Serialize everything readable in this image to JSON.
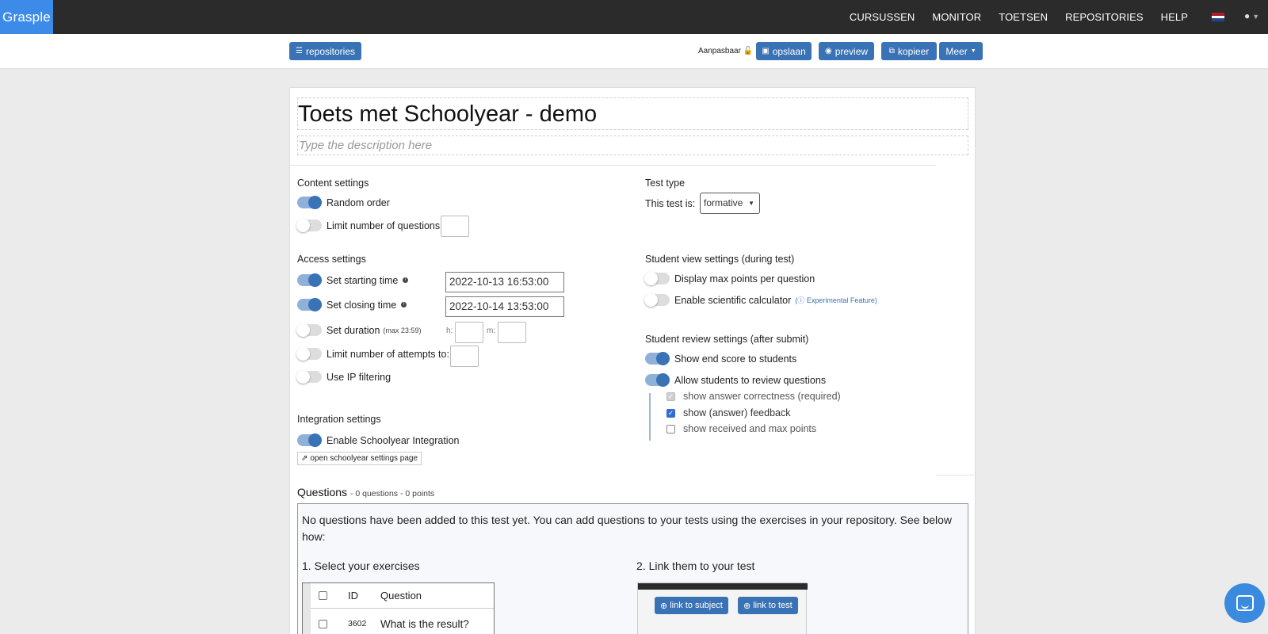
{
  "app": {
    "logo": "Grasple"
  },
  "nav": {
    "items": [
      {
        "label": "CURSUSSEN"
      },
      {
        "label": "MONITOR"
      },
      {
        "label": "TOETSEN"
      },
      {
        "label": "REPOSITORIES"
      },
      {
        "label": "HELP"
      }
    ],
    "language_flag": "flag-nl-icon",
    "user": "user-icon"
  },
  "toolbar": {
    "repositories": "repositories",
    "editable_label": "Aanpasbaar",
    "save": "opslaan",
    "preview": "preview",
    "copy": "kopieer",
    "more": "Meer"
  },
  "test": {
    "title": "Toets met Schoolyear - demo",
    "description_placeholder": "Type the description here"
  },
  "content_settings": {
    "heading": "Content settings",
    "random_order": {
      "label": "Random order",
      "on": true
    },
    "limit_questions": {
      "label": "Limit number of questions",
      "on": false,
      "value": ""
    }
  },
  "access_settings": {
    "heading": "Access settings",
    "starting_time": {
      "label": "Set starting time",
      "on": true,
      "value": "2022-10-13 16:53:00"
    },
    "closing_time": {
      "label": "Set closing time",
      "on": true,
      "value": "2022-10-14 13:53:00"
    },
    "duration": {
      "label": "Set duration",
      "hint": "(max 23:59)",
      "on": false,
      "h_label": "h:",
      "m_label": "m:"
    },
    "attempts": {
      "label": "Limit number of attempts to:",
      "on": false
    },
    "ip_filtering": {
      "label": "Use IP filtering",
      "on": false
    }
  },
  "integration_settings": {
    "heading": "Integration settings",
    "schoolyear": {
      "label": "Enable Schoolyear Integration",
      "on": true
    },
    "open_settings": "open schoolyear settings page"
  },
  "test_type": {
    "heading": "Test type",
    "label": "This test is:",
    "value": "formative"
  },
  "student_view": {
    "heading": "Student view settings (during test)",
    "max_points": {
      "label": "Display max points per question",
      "on": false
    },
    "calculator": {
      "label": "Enable scientific calculator",
      "on": false,
      "experimental": "Experimental Feature"
    }
  },
  "student_review": {
    "heading": "Student review settings (after submit)",
    "end_score": {
      "label": "Show end score to students",
      "on": true
    },
    "review_questions": {
      "label": "Allow students to review questions",
      "on": true
    },
    "options": [
      {
        "label": "show answer correctness (required)",
        "checked": true,
        "disabled": true
      },
      {
        "label": "show (answer) feedback",
        "checked": true,
        "disabled": false
      },
      {
        "label": "show received and max points",
        "checked": false,
        "disabled": false
      }
    ]
  },
  "questions": {
    "heading": "Questions",
    "summary": "- 0 questions - 0 points",
    "empty_text": "No questions have been added to this test yet. You can add questions to your tests using the exercises in your repository. See below how:",
    "step1": "1. Select your exercises",
    "step2": "2. Link them to your test",
    "table": {
      "columns": [
        "ID",
        "Question"
      ],
      "rows": [
        {
          "id": "3602",
          "question": "What is the result?"
        }
      ]
    },
    "link_subject": "link to subject",
    "link_test": "link to test"
  },
  "colors": {
    "accent": "#3a72b6",
    "nav_bg": "#2b2b2b",
    "logo_bg": "#3d8be8"
  }
}
